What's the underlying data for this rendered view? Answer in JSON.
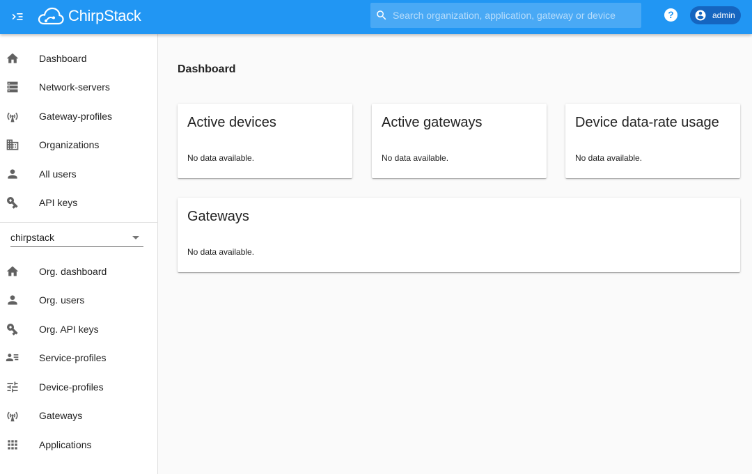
{
  "header": {
    "brand": "ChirpStack",
    "search_placeholder": "Search organization, application, gateway or device",
    "help_label": "?",
    "user_name": "admin",
    "colors": {
      "bar": "#2196f3",
      "user_chip": "#1565c0"
    }
  },
  "sidebar": {
    "global_items": [
      {
        "label": "Dashboard",
        "icon": "home-icon"
      },
      {
        "label": "Network-servers",
        "icon": "server-icon"
      },
      {
        "label": "Gateway-profiles",
        "icon": "radio-tower-icon"
      },
      {
        "label": "Organizations",
        "icon": "domain-icon"
      },
      {
        "label": "All users",
        "icon": "person-icon"
      },
      {
        "label": "API keys",
        "icon": "key-icon"
      }
    ],
    "organization_select": {
      "value": "chirpstack"
    },
    "org_items": [
      {
        "label": "Org. dashboard",
        "icon": "home-icon"
      },
      {
        "label": "Org. users",
        "icon": "person-icon"
      },
      {
        "label": "Org. API keys",
        "icon": "key-icon"
      },
      {
        "label": "Service-profiles",
        "icon": "account-details-icon"
      },
      {
        "label": "Device-profiles",
        "icon": "tune-icon"
      },
      {
        "label": "Gateways",
        "icon": "radio-tower-icon"
      },
      {
        "label": "Applications",
        "icon": "apps-grid-icon"
      }
    ]
  },
  "main": {
    "title": "Dashboard",
    "cards": [
      {
        "title": "Active devices",
        "body": "No data available."
      },
      {
        "title": "Active gateways",
        "body": "No data available."
      },
      {
        "title": "Device data-rate usage",
        "body": "No data available."
      },
      {
        "title": "Gateways",
        "body": "No data available."
      }
    ]
  }
}
